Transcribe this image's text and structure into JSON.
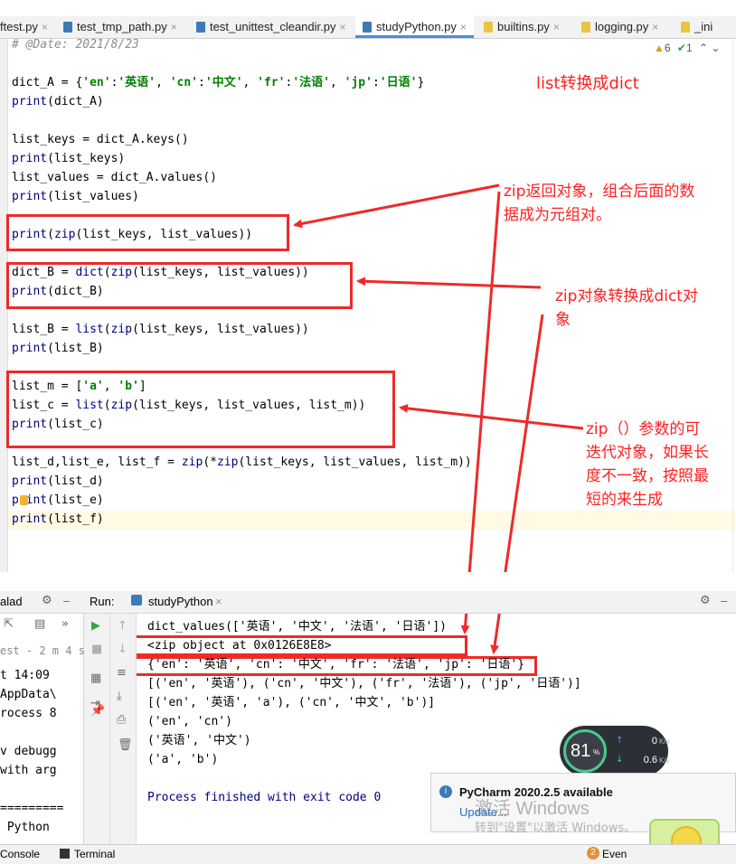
{
  "tabs": [
    {
      "label": "ftest.py",
      "icon": "python-file-icon",
      "color": "#e9c440"
    },
    {
      "label": "test_tmp_path.py",
      "icon": "python-file-icon",
      "color": "#3d7ab7"
    },
    {
      "label": "test_unittest_cleandir.py",
      "icon": "python-file-icon",
      "color": "#3d7ab7"
    },
    {
      "label": "studyPython.py",
      "icon": "python-file-icon",
      "color": "#3d7ab7",
      "active": true
    },
    {
      "label": "builtins.py",
      "icon": "python-file-icon",
      "color": "#e9c440"
    },
    {
      "label": "logging.py",
      "icon": "python-file-icon",
      "color": "#e9c440"
    },
    {
      "label": "_ini",
      "icon": "python-file-icon",
      "color": "#e9c440"
    }
  ],
  "inspections": {
    "warnings": "6",
    "ok": "1"
  },
  "code": {
    "l1": "# @Date: 2021/8/23",
    "l2a": "dict_A = {",
    "l2b": "'en'",
    "l2c": ":",
    "l2d": "'英语'",
    "l2e": ", ",
    "l2f": "'cn'",
    "l2g": "'中文'",
    "l2h": "'fr'",
    "l2i": "'法语'",
    "l2j": "'jp'",
    "l2k": "'日语'",
    "l2l": "}",
    "l3": "print(dict_A)",
    "l4": "list_keys = dict_A.keys()",
    "l5": "print(list_keys)",
    "l6": "list_values = dict_A.values()",
    "l7": "print(list_values)",
    "l8": "print(zip(list_keys, list_values))",
    "l9": "dict_B = dict(zip(list_keys, list_values))",
    "l10": "print(dict_B)",
    "l11": "list_B = list(zip(list_keys, list_values))",
    "l12": "print(list_B)",
    "l13a": "list_m = [",
    "l13b": "'a'",
    "l13c": ", ",
    "l13d": "'b'",
    "l13e": "]",
    "l14": "list_c = list(zip(list_keys, list_values, list_m))",
    "l15": "print(list_c)",
    "l16": "list_d,list_e, list_f = zip(*zip(list_keys, list_values, list_m))",
    "l17": "print(list_d)",
    "l18": "print(list_e)",
    "l19": "print(list_f)"
  },
  "annotations": {
    "title": "list转换成dict",
    "zip_return_1": "zip返回对象，组合后面的数",
    "zip_return_2": "据成为元组对。",
    "zip_dict_1": "zip对象转换成dict对",
    "zip_dict_2": "象",
    "zip_param_1": "zip（）参数的可",
    "zip_param_2": "迭代对象，如果长",
    "zip_param_3": "度不一致，按照最",
    "zip_param_4": "短的来生成"
  },
  "run_panel": {
    "left_tab": "alad",
    "run_label": "Run:",
    "config": "studyPython",
    "left_lines": [
      "est - 2 m 4 s",
      "t 14:09",
      "AppData\\",
      "rocess 8",
      "",
      "v debugg",
      "with arg",
      "",
      "=========",
      " Python"
    ]
  },
  "output": [
    "dict_values(['英语', '中文', '法语', '日语'])",
    "<zip object at 0x0126E8E8>",
    "{'en': '英语', 'cn': '中文', 'fr': '法语', 'jp': '日语'}",
    "[('en', '英语'), ('cn', '中文'), ('fr', '法语'), ('jp', '日语')]",
    "[('en', '英语', 'a'), ('cn', '中文', 'b')]",
    "('en', 'cn')",
    "('英语', '中文')",
    "('a', 'b')",
    "",
    "Process finished with exit code 0"
  ],
  "net_widget": {
    "cpu": "81",
    "cpu_unit": "%",
    "up": "0",
    "down": "0.6",
    "unit": "K/s"
  },
  "notification": {
    "title": "PyCharm 2020.2.5 available",
    "link": "Update..."
  },
  "watermark": {
    "line1": "激活 Windows",
    "line2": "转到\"设置\"以激活 Windows。"
  },
  "statusbar": {
    "console": "Console",
    "terminal": "Terminal",
    "event_count": "2",
    "event_label": "Even"
  },
  "colors": {
    "annotation": "#ff2020",
    "keyword": "#000080",
    "string": "#008000",
    "exit": "#000080",
    "tab_active": "#4a8ed8"
  }
}
